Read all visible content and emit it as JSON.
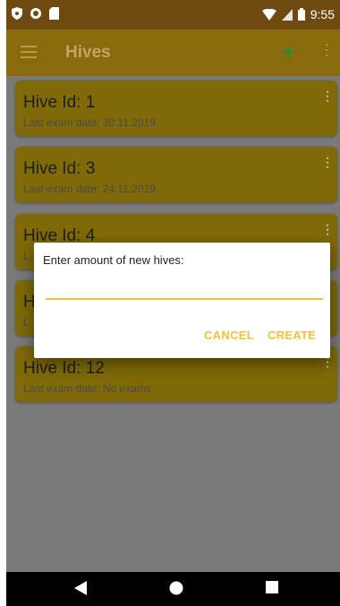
{
  "status_bar": {
    "time": "9:55",
    "icons": [
      "shield-icon",
      "record-icon",
      "sd-card-icon",
      "wifi-icon",
      "signal-icon",
      "battery-icon"
    ]
  },
  "app_bar": {
    "title": "Hives",
    "add_icon": "add-icon",
    "menu_icon": "hamburger-menu-icon",
    "overflow_icon": "more-vertical-icon"
  },
  "hives": [
    {
      "id_label": "Hive Id: 1",
      "exam_label": "Last exam date: 30.11.2019."
    },
    {
      "id_label": "Hive Id: 3",
      "exam_label": "Last exam date: 24.11.2019."
    },
    {
      "id_label": "Hive Id: 4",
      "exam_label": "L"
    },
    {
      "id_label": "H",
      "exam_label": "L"
    },
    {
      "id_label": "Hive Id: 12",
      "exam_label": "Last exam date: No exams"
    }
  ],
  "dialog": {
    "title": "Enter amount of new hives:",
    "input_value": "",
    "cancel_label": "CANCEL",
    "create_label": "CREATE"
  },
  "nav_bar": {
    "icons": [
      "back-icon",
      "home-icon",
      "recents-icon"
    ]
  },
  "colors": {
    "accent": "#f3c23c",
    "status_bar": "#6e4a11",
    "app_bar": "#8a6b0b",
    "card": "#7f6a07",
    "add": "#2e8b2e"
  }
}
